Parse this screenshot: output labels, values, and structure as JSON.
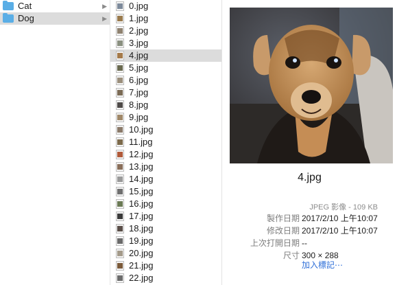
{
  "folders": [
    {
      "label": "Cat",
      "selected": false
    },
    {
      "label": "Dog",
      "selected": true
    }
  ],
  "files": [
    {
      "name": "0.jpg",
      "thumb": "#7d8a9b"
    },
    {
      "name": "1.jpg",
      "thumb": "#9a7a4c"
    },
    {
      "name": "2.jpg",
      "thumb": "#8f8270"
    },
    {
      "name": "3.jpg",
      "thumb": "#8a9080"
    },
    {
      "name": "4.jpg",
      "thumb": "#a57a4a",
      "selected": true
    },
    {
      "name": "5.jpg",
      "thumb": "#6a6a4f"
    },
    {
      "name": "6.jpg",
      "thumb": "#9b8f7c"
    },
    {
      "name": "7.jpg",
      "thumb": "#7b6b55"
    },
    {
      "name": "8.jpg",
      "thumb": "#4e4a48"
    },
    {
      "name": "9.jpg",
      "thumb": "#a08868"
    },
    {
      "name": "10.jpg",
      "thumb": "#8b7a6a"
    },
    {
      "name": "11.jpg",
      "thumb": "#7c6a4b"
    },
    {
      "name": "12.jpg",
      "thumb": "#b05a3a"
    },
    {
      "name": "13.jpg",
      "thumb": "#8a6f5a"
    },
    {
      "name": "14.jpg",
      "thumb": "#9a9a9a"
    },
    {
      "name": "15.jpg",
      "thumb": "#6f6f6f"
    },
    {
      "name": "16.jpg",
      "thumb": "#6b7a55"
    },
    {
      "name": "17.jpg",
      "thumb": "#3a3a3a"
    },
    {
      "name": "18.jpg",
      "thumb": "#5a4e48"
    },
    {
      "name": "19.jpg",
      "thumb": "#6a6a6a"
    },
    {
      "name": "20.jpg",
      "thumb": "#a49a8a"
    },
    {
      "name": "21.jpg",
      "thumb": "#7b5a3a"
    },
    {
      "name": "22.jpg",
      "thumb": "#6c6c6c"
    }
  ],
  "preview": {
    "filename": "4.jpg",
    "kind_size": "JPEG 影像 - 109 KB",
    "meta": [
      {
        "label": "製作日期",
        "value": "2017/2/10 上午10:07"
      },
      {
        "label": "修改日期",
        "value": "2017/2/10 上午10:07"
      },
      {
        "label": "上次打開日期",
        "value": "--"
      },
      {
        "label": "尺寸",
        "value": "300 × 288"
      }
    ],
    "add_tags": "加入標記⋯"
  },
  "colors": {
    "selection": "#dcdcdc",
    "folder": "#5aaee6",
    "link": "#2f6fd8"
  }
}
